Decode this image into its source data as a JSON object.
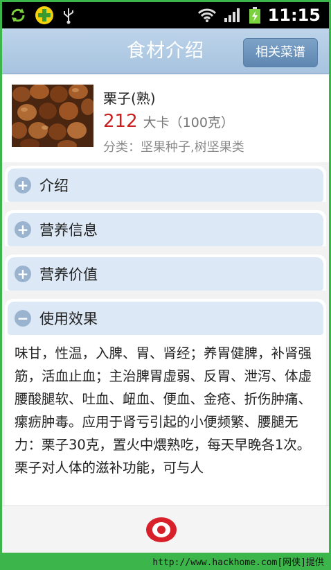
{
  "status_bar": {
    "time": "11:15",
    "left_icons": [
      "sync-icon",
      "plus-app-icon",
      "usb-icon"
    ],
    "right_icons": [
      "wifi-icon",
      "signal-icon",
      "battery-charging-icon"
    ]
  },
  "header": {
    "title": "食材介绍",
    "recipes_button": "相关菜谱"
  },
  "food": {
    "name": "栗子(熟)",
    "calories": "212",
    "calorie_unit": "大卡（100克）",
    "category": "分类：坚果种子,树坚果类",
    "image_icon": "chestnut-photo"
  },
  "sections": [
    {
      "label": "介绍",
      "expanded": false
    },
    {
      "label": "营养信息",
      "expanded": false
    },
    {
      "label": "营养价值",
      "expanded": false
    },
    {
      "label": "使用效果",
      "expanded": true
    }
  ],
  "expanded_text": "味甘，性温，入脾、胃、肾经；养胃健脾，补肾强筋，活血止血；主治脾胃虚弱、反胃、泄泻、体虚腰酸腿软、吐血、衄血、便血、金疮、折伤肿痛、瘰疬肿毒。应用于肾亏引起的小便频繁、腰腿无力：栗子30克，置火中煨熟吃，每天早晚各1次。栗子对人体的滋补功能，可与人",
  "bottom": {
    "icon": "target-icon"
  },
  "watermark": "http://www.hackhome.com[网侠]提供",
  "colors": {
    "header_bg": "#a7c3df",
    "section_bg": "#dce8f5",
    "calorie": "#c8201f",
    "accent_red": "#d8202a",
    "frame_green": "#3cb54a"
  }
}
